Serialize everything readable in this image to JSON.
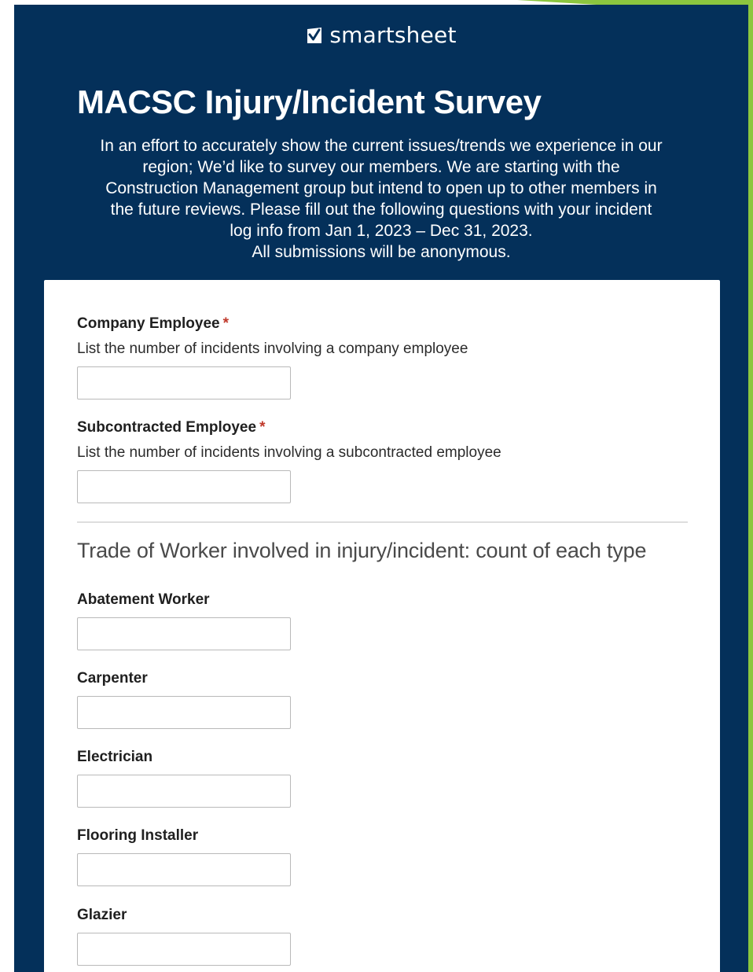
{
  "brand": {
    "name": "smartsheet",
    "icon": "smartsheet-check-logo-icon"
  },
  "form": {
    "title": "MACSC Injury/Incident Survey",
    "description_lines": [
      "In an effort to accurately show the current issues/trends we experience in our",
      "region; We’d like to survey our members. We are starting with the",
      "Construction Management group but intend to open up to other members in",
      "the future reviews. Please fill out the following questions with your incident",
      "log info from Jan 1, 2023 – Dec 31, 2023.",
      "All submissions will be anonymous."
    ]
  },
  "fields": {
    "company_employee": {
      "label": "Company Employee",
      "required_mark": "*",
      "help": "List the number of incidents involving a company employee",
      "value": ""
    },
    "subcontracted_employee": {
      "label": "Subcontracted Employee",
      "required_mark": "*",
      "help": "List the number of incidents involving a subcontracted employee",
      "value": ""
    }
  },
  "trade_section": {
    "heading": "Trade of Worker involved in injury/incident: count of each type",
    "trades": [
      {
        "label": "Abatement Worker",
        "value": ""
      },
      {
        "label": "Carpenter",
        "value": ""
      },
      {
        "label": "Electrician",
        "value": ""
      },
      {
        "label": "Flooring Installer",
        "value": ""
      },
      {
        "label": "Glazier",
        "value": ""
      }
    ]
  },
  "colors": {
    "header_background": "#04305a",
    "accent_green": "#8cc63f",
    "required_red": "#c0392b"
  }
}
